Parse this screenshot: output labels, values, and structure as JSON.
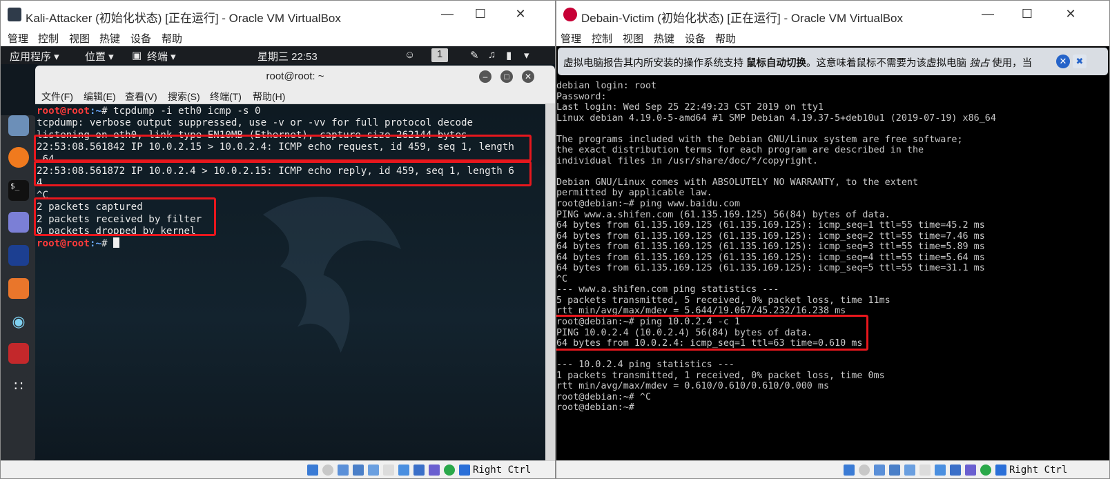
{
  "left_window": {
    "title": "Kali-Attacker (初始化状态) [正在运行] - Oracle VM VirtualBox",
    "menu": [
      "管理",
      "控制",
      "视图",
      "热键",
      "设备",
      "帮助"
    ],
    "controls": {
      "minimize": "—",
      "maximize": "☐",
      "close": "✕"
    },
    "host_key": "Right Ctrl"
  },
  "right_window": {
    "title": "Debain-Victim (初始化状态) [正在运行] - Oracle VM VirtualBox",
    "menu": [
      "管理",
      "控制",
      "视图",
      "热键",
      "设备",
      "帮助"
    ],
    "controls": {
      "minimize": "—",
      "maximize": "☐",
      "close": "✕"
    },
    "host_key": "Right Ctrl"
  },
  "kali": {
    "panel": {
      "apps": "应用程序 ▾",
      "places": "位置 ▾",
      "terminal": "终端 ▾",
      "clock": "星期三 22:53",
      "workspace": "1"
    },
    "terminal": {
      "title": "root@root: ~",
      "menu": [
        "文件(F)",
        "编辑(E)",
        "查看(V)",
        "搜索(S)",
        "终端(T)",
        "帮助(H)"
      ],
      "prompt_user": "root@root",
      "prompt_path": ":~",
      "command": "# tcpdump -i eth0 icmp -s 0",
      "lines": [
        "tcpdump: verbose output suppressed, use -v or -vv for full protocol decode",
        "listening on eth0, link-type EN10MB (Ethernet), capture size 262144 bytes",
        "22:53:08.561842 IP 10.0.2.15 > 10.0.2.4: ICMP echo request, id 459, seq 1, length",
        " 64",
        "22:53:08.561872 IP 10.0.2.4 > 10.0.2.15: ICMP echo reply, id 459, seq 1, length 6",
        "4",
        "^C",
        "2 packets captured",
        "2 packets received by filter",
        "0 packets dropped by kernel"
      ],
      "final_prompt_suffix": "# "
    }
  },
  "debian": {
    "notice": {
      "text_prefix": "虚拟电脑报告其内所安装的操作系统支持 ",
      "text_bold": "鼠标自动切换",
      "text_middle": "。这意味着鼠标不需要为该虚拟电脑 ",
      "text_italic": "独占",
      "text_suffix": " 使用，当"
    },
    "console": [
      "debian login: root",
      "Password:",
      "Last login: Wed Sep 25 22:49:23 CST 2019 on tty1",
      "Linux debian 4.19.0-5-amd64 #1 SMP Debian 4.19.37-5+deb10u1 (2019-07-19) x86_64",
      "",
      "The programs included with the Debian GNU/Linux system are free software;",
      "the exact distribution terms for each program are described in the",
      "individual files in /usr/share/doc/*/copyright.",
      "",
      "Debian GNU/Linux comes with ABSOLUTELY NO WARRANTY, to the extent",
      "permitted by applicable law.",
      "root@debian:~# ping www.baidu.com",
      "PING www.a.shifen.com (61.135.169.125) 56(84) bytes of data.",
      "64 bytes from 61.135.169.125 (61.135.169.125): icmp_seq=1 ttl=55 time=45.2 ms",
      "64 bytes from 61.135.169.125 (61.135.169.125): icmp_seq=2 ttl=55 time=7.46 ms",
      "64 bytes from 61.135.169.125 (61.135.169.125): icmp_seq=3 ttl=55 time=5.89 ms",
      "64 bytes from 61.135.169.125 (61.135.169.125): icmp_seq=4 ttl=55 time=5.64 ms",
      "64 bytes from 61.135.169.125 (61.135.169.125): icmp_seq=5 ttl=55 time=31.1 ms",
      "^C",
      "--- www.a.shifen.com ping statistics ---",
      "5 packets transmitted, 5 received, 0% packet loss, time 11ms",
      "rtt min/avg/max/mdev = 5.644/19.067/45.232/16.238 ms",
      "root@debian:~# ping 10.0.2.4 -c 1",
      "PING 10.0.2.4 (10.0.2.4) 56(84) bytes of data.",
      "64 bytes from 10.0.2.4: icmp_seq=1 ttl=63 time=0.610 ms",
      "",
      "--- 10.0.2.4 ping statistics ---",
      "1 packets transmitted, 1 received, 0% packet loss, time 0ms",
      "rtt min/avg/max/mdev = 0.610/0.610/0.610/0.000 ms",
      "root@debian:~# ^C",
      "root@debian:~#"
    ]
  },
  "colors": {
    "highlight_box": "#e8171d",
    "kali_prompt_user": "#ff3b3b",
    "kali_prompt_path": "#6aa8ff",
    "notice_button": "#2563c9"
  }
}
